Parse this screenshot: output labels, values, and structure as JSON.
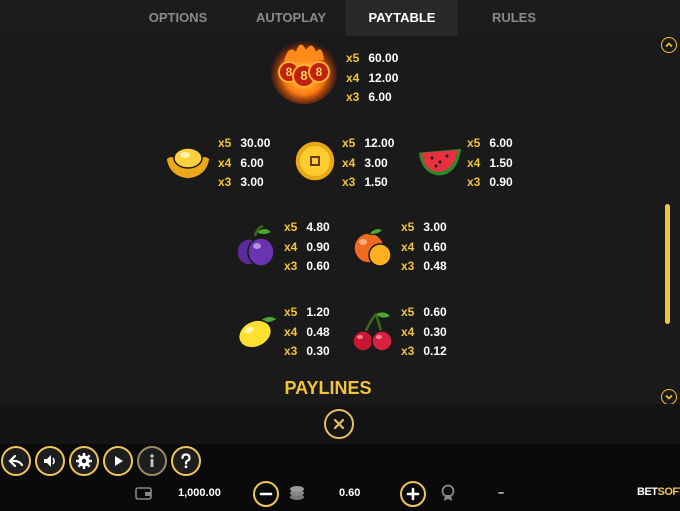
{
  "tabs": [
    {
      "label": "OPTIONS"
    },
    {
      "label": "AUTOPLAY"
    },
    {
      "label": "PAYTABLE"
    },
    {
      "label": "RULES"
    }
  ],
  "active_tab": "PAYTABLE",
  "paytable": {
    "top": {
      "symbol": "888-fire-icon",
      "pays": [
        {
          "m": "x5",
          "v": "60.00"
        },
        {
          "m": "x4",
          "v": "12.00"
        },
        {
          "m": "x3",
          "v": "6.00"
        }
      ]
    },
    "row1": [
      {
        "symbol": "gold-ingot-icon",
        "pays": [
          {
            "m": "x5",
            "v": "30.00"
          },
          {
            "m": "x4",
            "v": "6.00"
          },
          {
            "m": "x3",
            "v": "3.00"
          }
        ]
      },
      {
        "symbol": "gold-coin-icon",
        "pays": [
          {
            "m": "x5",
            "v": "12.00"
          },
          {
            "m": "x4",
            "v": "3.00"
          },
          {
            "m": "x3",
            "v": "1.50"
          }
        ]
      },
      {
        "symbol": "watermelon-icon",
        "pays": [
          {
            "m": "x5",
            "v": "6.00"
          },
          {
            "m": "x4",
            "v": "1.50"
          },
          {
            "m": "x3",
            "v": "0.90"
          }
        ]
      }
    ],
    "row2": [
      {
        "symbol": "plum-icon",
        "pays": [
          {
            "m": "x5",
            "v": "4.80"
          },
          {
            "m": "x4",
            "v": "0.90"
          },
          {
            "m": "x3",
            "v": "0.60"
          }
        ]
      },
      {
        "symbol": "orange-icon",
        "pays": [
          {
            "m": "x5",
            "v": "3.00"
          },
          {
            "m": "x4",
            "v": "0.60"
          },
          {
            "m": "x3",
            "v": "0.48"
          }
        ]
      }
    ],
    "row3": [
      {
        "symbol": "lemon-icon",
        "pays": [
          {
            "m": "x5",
            "v": "1.20"
          },
          {
            "m": "x4",
            "v": "0.48"
          },
          {
            "m": "x3",
            "v": "0.30"
          }
        ]
      },
      {
        "symbol": "cherry-icon",
        "pays": [
          {
            "m": "x5",
            "v": "0.60"
          },
          {
            "m": "x4",
            "v": "0.30"
          },
          {
            "m": "x3",
            "v": "0.12"
          }
        ]
      }
    ],
    "section_title": "PAYLINES"
  },
  "bottom": {
    "balance": "1,000.00",
    "bet": "0.60",
    "win": "–",
    "brand_a": "BET",
    "brand_b": "SOFT"
  },
  "colors": {
    "accent": "#f2c43b",
    "background": "#1a1a1a"
  }
}
